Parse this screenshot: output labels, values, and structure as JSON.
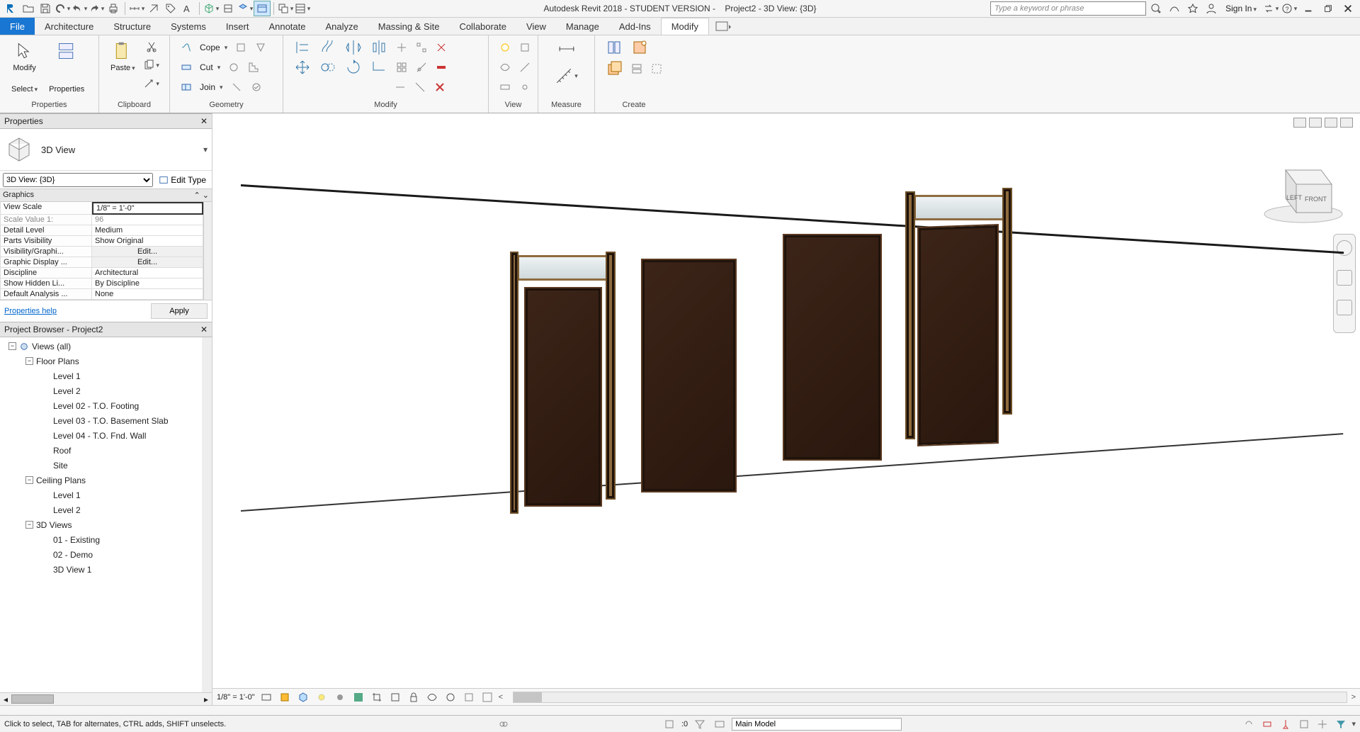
{
  "titlebar": {
    "app_title": "Autodesk Revit 2018 - STUDENT VERSION -",
    "doc_title": "Project2 - 3D View: {3D}",
    "search_placeholder": "Type a keyword or phrase",
    "signin": "Sign In"
  },
  "tabs": {
    "file": "File",
    "list": [
      "Architecture",
      "Structure",
      "Systems",
      "Insert",
      "Annotate",
      "Analyze",
      "Massing & Site",
      "Collaborate",
      "View",
      "Manage",
      "Add-Ins",
      "Modify"
    ],
    "active": "Modify"
  },
  "ribbon": {
    "select": {
      "modify": "Modify",
      "select": "Select",
      "properties": "Properties",
      "panel": "Properties"
    },
    "clipboard": {
      "paste": "Paste",
      "panel": "Clipboard"
    },
    "geometry": {
      "cope": "Cope",
      "cut": "Cut",
      "join": "Join",
      "panel": "Geometry"
    },
    "modify": {
      "panel": "Modify"
    },
    "view": {
      "panel": "View"
    },
    "measure": {
      "panel": "Measure"
    },
    "create": {
      "panel": "Create"
    }
  },
  "properties": {
    "title": "Properties",
    "type_name": "3D View",
    "filter_label": "3D View: {3D}",
    "edit_type": "Edit Type",
    "group": "Graphics",
    "rows": [
      {
        "k": "View Scale",
        "v": "1/8\" = 1'-0\""
      },
      {
        "k": "Scale Value    1:",
        "v": "96",
        "gray": true
      },
      {
        "k": "Detail Level",
        "v": "Medium"
      },
      {
        "k": "Parts Visibility",
        "v": "Show Original"
      },
      {
        "k": "Visibility/Graphi...",
        "v": "Edit...",
        "btn": true
      },
      {
        "k": "Graphic Display ...",
        "v": "Edit...",
        "btn": true
      },
      {
        "k": "Discipline",
        "v": "Architectural"
      },
      {
        "k": "Show Hidden Li...",
        "v": "By Discipline"
      },
      {
        "k": "Default Analysis ...",
        "v": "None"
      }
    ],
    "help": "Properties help",
    "apply": "Apply"
  },
  "browser": {
    "title": "Project Browser - Project2",
    "tree": [
      {
        "indent": 0,
        "toggle": "-",
        "icon": true,
        "label": "Views (all)"
      },
      {
        "indent": 1,
        "toggle": "-",
        "label": "Floor Plans"
      },
      {
        "indent": 2,
        "label": "Level 1"
      },
      {
        "indent": 2,
        "label": "Level 2"
      },
      {
        "indent": 2,
        "label": "Level 02 - T.O. Footing"
      },
      {
        "indent": 2,
        "label": "Level 03 - T.O. Basement Slab"
      },
      {
        "indent": 2,
        "label": "Level 04 - T.O. Fnd. Wall"
      },
      {
        "indent": 2,
        "label": "Roof"
      },
      {
        "indent": 2,
        "label": "Site"
      },
      {
        "indent": 1,
        "toggle": "-",
        "label": "Ceiling Plans"
      },
      {
        "indent": 2,
        "label": "Level 1"
      },
      {
        "indent": 2,
        "label": "Level 2"
      },
      {
        "indent": 1,
        "toggle": "-",
        "label": "3D Views"
      },
      {
        "indent": 2,
        "label": "01 - Existing"
      },
      {
        "indent": 2,
        "label": "02 - Demo"
      },
      {
        "indent": 2,
        "label": "3D View 1"
      }
    ]
  },
  "viewbar": {
    "scale": "1/8\" = 1'-0\""
  },
  "viewcube": {
    "left": "LEFT",
    "front": "FRONT"
  },
  "status": {
    "msg": "Click to select, TAB for alternates, CTRL adds, SHIFT unselects.",
    "sel": ":0",
    "model": "Main Model"
  }
}
